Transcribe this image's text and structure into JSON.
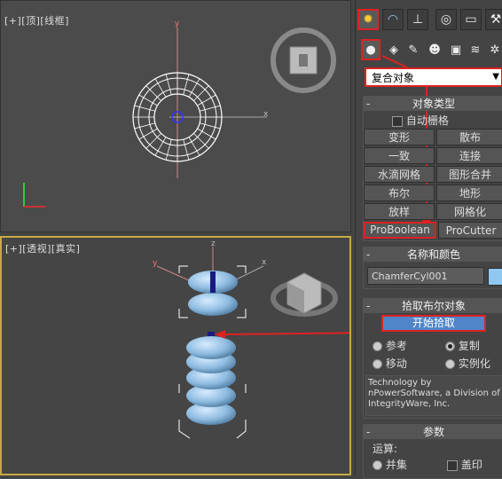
{
  "viewports": {
    "top_label": "[+][顶][线框]",
    "persp_label": "[+][透视][真实]"
  },
  "panel": {
    "tabs": [
      "create-tab",
      "modify-tab",
      "hierarchy-tab",
      "motion-tab",
      "display-tab",
      "utilities-tab"
    ],
    "category_dropdown": "复合对象",
    "object_type": {
      "title": "对象类型",
      "autogrid_label": "自动栅格",
      "buttons": [
        "变形",
        "散布",
        "一致",
        "连接",
        "水滴网格",
        "图形合并",
        "布尔",
        "地形",
        "放样",
        "网格化",
        "ProBoolean",
        "ProCutter"
      ]
    },
    "name_color": {
      "title": "名称和颜色",
      "name_value": "ChamferCyl001",
      "color": "#8fc8f0"
    },
    "pick_boolean": {
      "title": "拾取布尔对象",
      "start_pick": "开始拾取",
      "opt_reference": "参考",
      "opt_copy": "复制",
      "opt_move": "移动",
      "opt_instance": "实例化",
      "info": "Technology by nPowerSoftware, a Division of IntegrityWare, Inc."
    },
    "params": {
      "title": "参数",
      "operation_label": "运算:",
      "opt_union": "并集",
      "imprint_label": "盖印"
    }
  }
}
